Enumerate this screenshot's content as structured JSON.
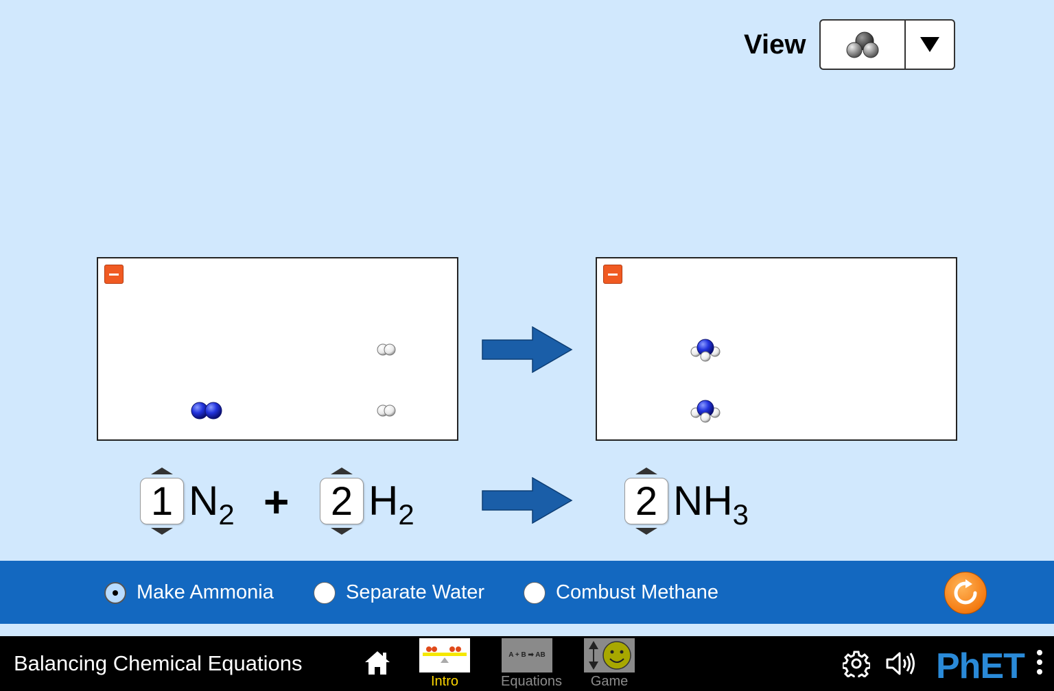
{
  "view_selector": {
    "label": "View",
    "selected_icon": "ball-and-stick-molecule-icon",
    "dropdown_icon": "triangle-down-icon"
  },
  "reactant_box": {
    "collapse_icon": "minus-icon",
    "molecules": [
      "N2",
      "H2",
      "H2"
    ]
  },
  "product_box": {
    "collapse_icon": "minus-icon",
    "molecules": [
      "NH3",
      "NH3"
    ]
  },
  "equation": {
    "reactants": [
      {
        "coefficient": "1",
        "symbol": "N",
        "subscript": "2"
      },
      {
        "coefficient": "2",
        "symbol": "H",
        "subscript": "2"
      }
    ],
    "plus": "+",
    "products": [
      {
        "coefficient": "2",
        "symbol": "NH",
        "subscript": "3"
      }
    ]
  },
  "reaction_choices": {
    "options": [
      "Make Ammonia",
      "Separate Water",
      "Combust Methane"
    ],
    "selected": "Make Ammonia"
  },
  "nav": {
    "title": "Balancing Chemical Equations",
    "tabs": [
      {
        "label": "Intro",
        "active": true,
        "thumb_text": ""
      },
      {
        "label": "Equations",
        "active": false,
        "thumb_text": "A + B ➡ AB"
      },
      {
        "label": "Game",
        "active": false,
        "thumb_text": ""
      }
    ],
    "logo": "PhET"
  },
  "colors": {
    "background": "#d1e8fd",
    "control_bar": "#1368c0",
    "arrow": "#1a5ea8",
    "nitrogen": "#2233dd",
    "hydrogen": "#ffffff",
    "active_tab": "#ffd700",
    "reset": "#f47b12"
  }
}
